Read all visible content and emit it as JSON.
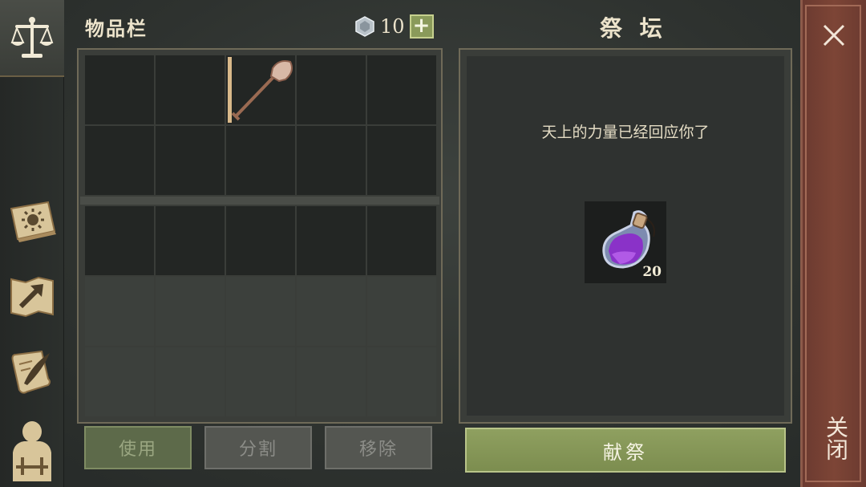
{
  "inventory": {
    "title": "物品栏",
    "currency_icon": "silver-gem-icon",
    "currency_count": "10",
    "add_icon": "plus-icon",
    "slots": [
      {
        "item": null
      },
      {
        "item": null
      },
      {
        "item": "shovel-icon"
      },
      {
        "item": null
      },
      {
        "item": null
      },
      {
        "item": null
      },
      {
        "item": null
      },
      {
        "item": null
      },
      {
        "item": null
      },
      {
        "item": null
      }
    ],
    "bag_slots_unlocked": 5,
    "bag_slots_locked": 10,
    "buttons": {
      "use": "使用",
      "split": "分割",
      "remove": "移除"
    }
  },
  "altar": {
    "title": "祭 坛",
    "message": "天上的力量已经回应你了",
    "offering": {
      "icon": "purple-potion-icon",
      "quantity": "20"
    },
    "sacrifice_button": "献祭"
  },
  "close": {
    "label": "关闭",
    "icon": "close-icon"
  },
  "sidebar": {
    "tabs": [
      {
        "icon": "scales-icon",
        "active": true
      },
      {
        "icon": "sun-book-icon",
        "active": false
      },
      {
        "icon": "map-arrow-icon",
        "active": false
      },
      {
        "icon": "quill-scroll-icon",
        "active": false
      },
      {
        "icon": "character-silhouette-icon",
        "active": false
      }
    ]
  },
  "colors": {
    "accent_green": "#8fa060",
    "close_red": "#7d4536",
    "frame_gold": "#6f6a58"
  }
}
